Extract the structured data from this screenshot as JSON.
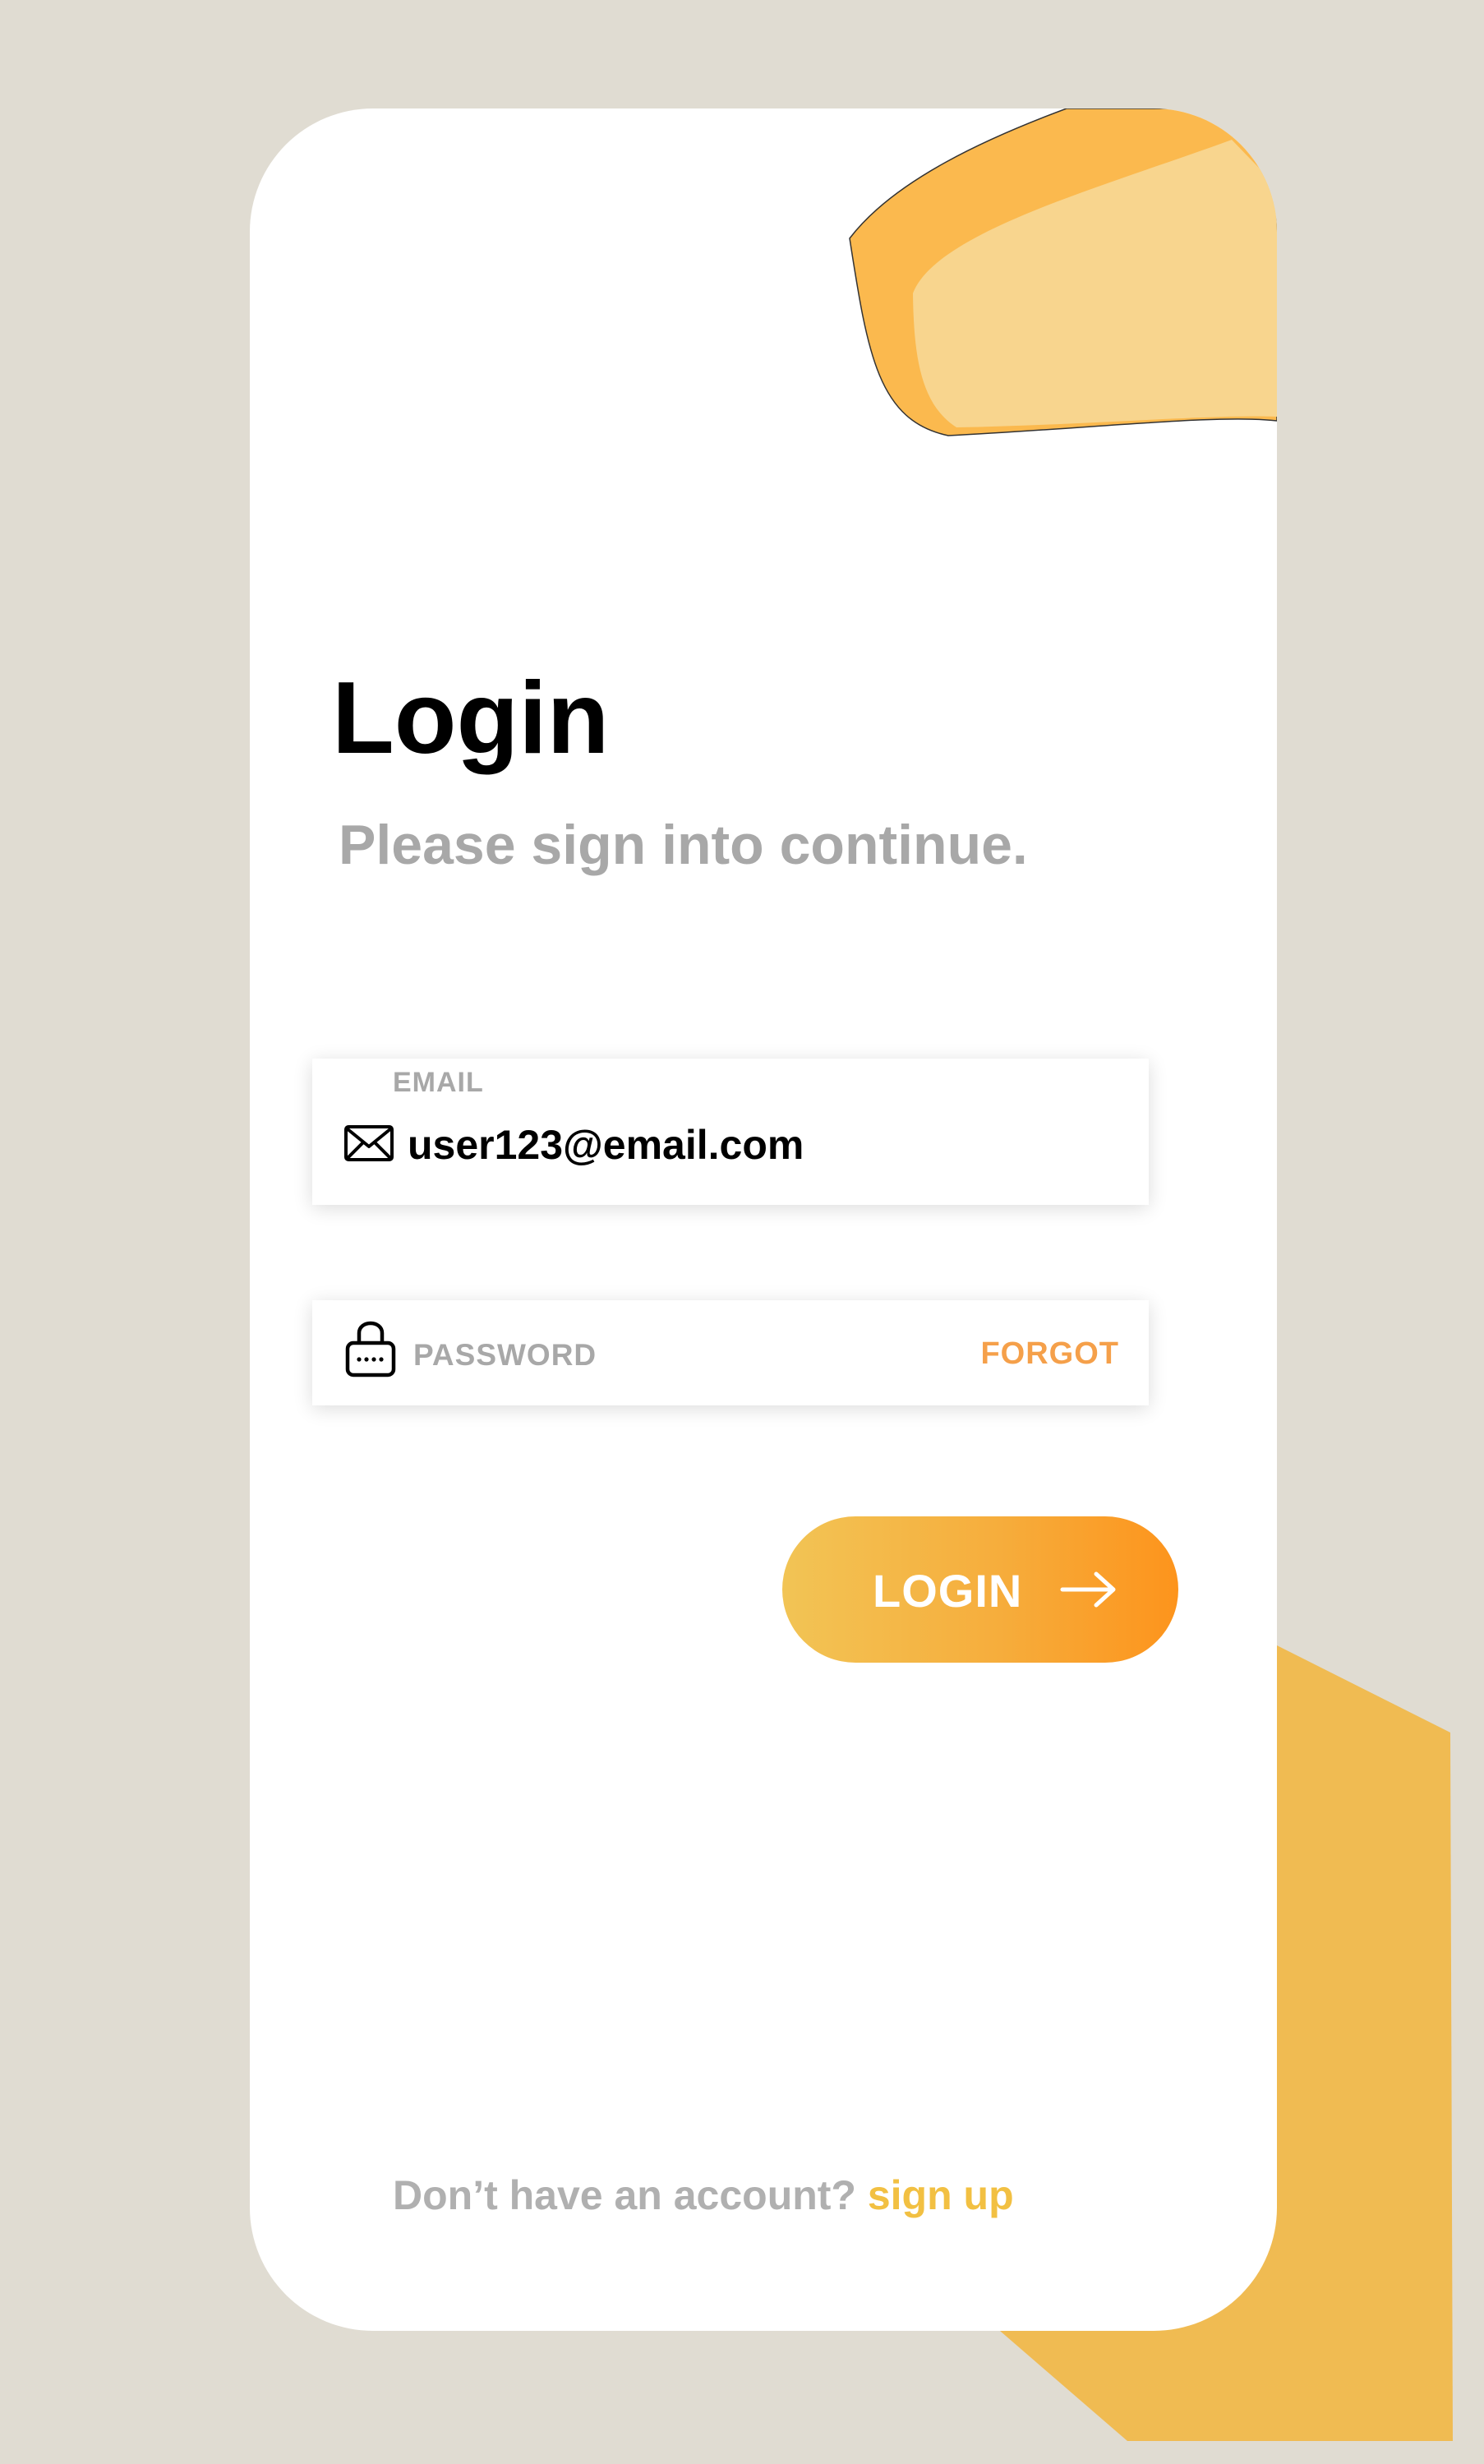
{
  "login": {
    "title": "Login",
    "subtitle": "Please sign into continue.",
    "email": {
      "label": "EMAIL",
      "value": "user123@email.com",
      "icon": "mail-icon"
    },
    "password": {
      "placeholder": "PASSWORD",
      "icon": "lock-icon",
      "forgot_label": "FORGOT"
    },
    "submit": {
      "label": "LOGIN",
      "icon": "arrow-right-icon"
    },
    "footer": {
      "text": "Don’t have an account? ",
      "link": "sign up"
    }
  },
  "colors": {
    "background": "#e0dcd2",
    "card": "#ffffff",
    "accent_orange": "#fd941c",
    "accent_yellow": "#f2c455",
    "forgot": "#f5a04a",
    "signup": "#f2c042",
    "muted_text": "#a8a8a8",
    "decor_shape": "#f0bb52"
  }
}
